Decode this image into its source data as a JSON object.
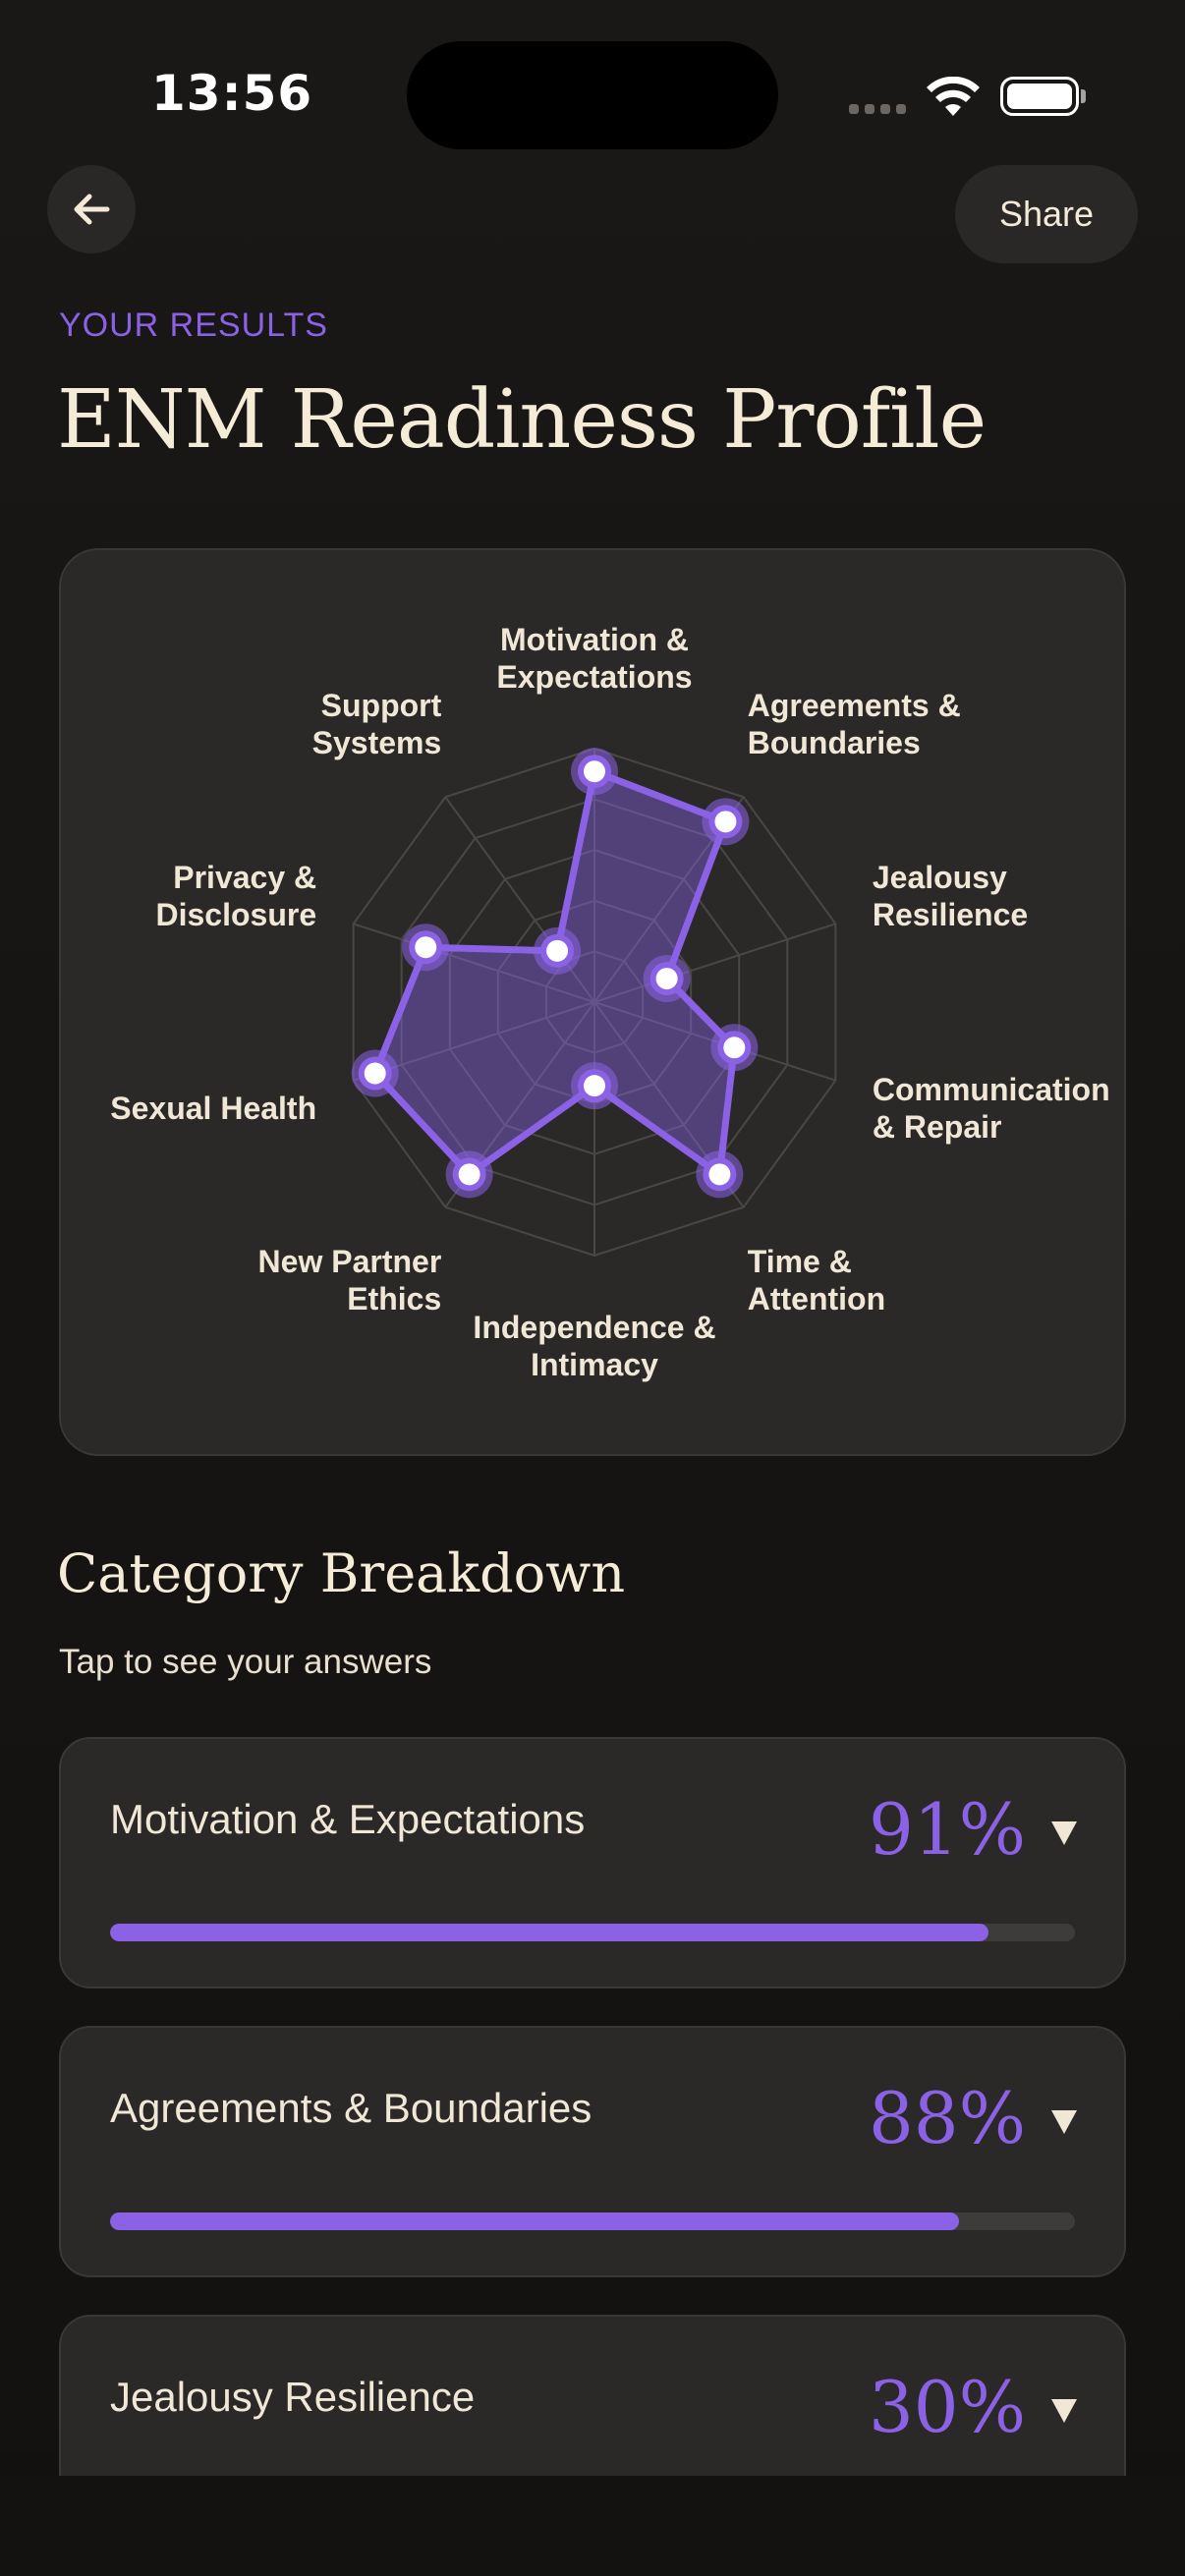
{
  "status": {
    "time": "13:56"
  },
  "nav": {
    "share_label": "Share"
  },
  "header": {
    "eyebrow": "YOUR RESULTS",
    "title": "ENM Readiness Profile"
  },
  "colors": {
    "accent": "#8b62e6",
    "background": "#141210",
    "card": "#2a2928",
    "text": "#f3ead9"
  },
  "chart_data": {
    "type": "radar",
    "grid": true,
    "axes": [
      {
        "label": [
          "Motivation &",
          "Expectations"
        ],
        "value": 91
      },
      {
        "label": [
          "Agreements &",
          "Boundaries"
        ],
        "value": 88
      },
      {
        "label": [
          "Jealousy",
          "Resilience"
        ],
        "value": 30
      },
      {
        "label": [
          "Communication",
          "& Repair"
        ],
        "value": 58
      },
      {
        "label": [
          "Time &",
          "Attention"
        ],
        "value": 84
      },
      {
        "label": [
          "Independence &",
          "Intimacy"
        ],
        "value": 33
      },
      {
        "label": [
          "New Partner",
          "Ethics"
        ],
        "value": 84
      },
      {
        "label": [
          "Sexual Health"
        ],
        "value": 91
      },
      {
        "label": [
          "Privacy &",
          "Disclosure"
        ],
        "value": 70
      },
      {
        "label": [
          "Support",
          "Systems"
        ],
        "value": 25
      }
    ]
  },
  "breakdown": {
    "title": "Category Breakdown",
    "subtitle": "Tap to see your answers",
    "items": [
      {
        "name": "Motivation & Expectations",
        "percent": "91%",
        "progress": 0.91
      },
      {
        "name": "Agreements & Boundaries",
        "percent": "88%",
        "progress": 0.88
      },
      {
        "name": "Jealousy Resilience",
        "percent": "30%",
        "progress": 0.3
      }
    ]
  }
}
